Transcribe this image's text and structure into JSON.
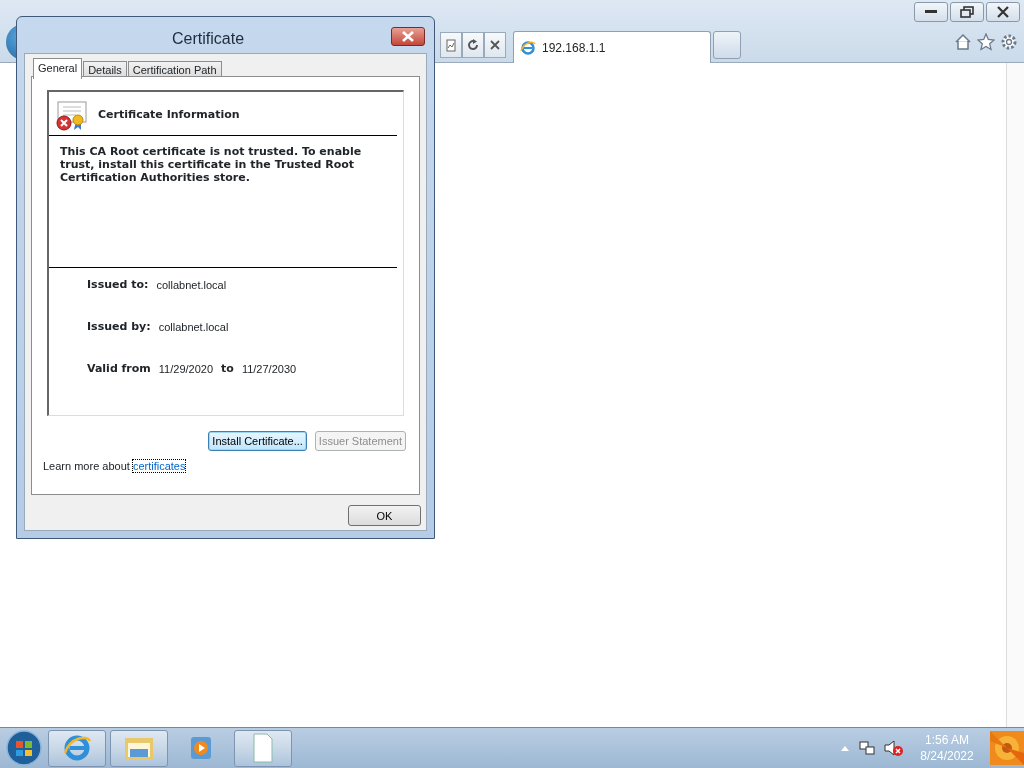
{
  "browser": {
    "tabs": [
      {
        "label": "192.168.1.1",
        "selected": true
      }
    ]
  },
  "dialog": {
    "title": "Certificate",
    "tabs": [
      {
        "label": "General",
        "selected": true
      },
      {
        "label": "Details",
        "selected": false
      },
      {
        "label": "Certification Path",
        "selected": false
      }
    ],
    "heading": "Certificate Information",
    "message": "This CA Root certificate is not trusted. To enable trust, install this certificate in the Trusted Root Certification Authorities store.",
    "fields": [
      {
        "label": "Issued to:",
        "value": "collabnet.local"
      },
      {
        "label": "Issued by:",
        "value": "collabnet.local"
      }
    ],
    "validity": {
      "from_label": "Valid from",
      "from": "11/29/2020",
      "to_label": "to",
      "to": "11/27/2030"
    },
    "buttons": [
      {
        "label": "Install Certificate...",
        "disabled": false
      },
      {
        "label": "Issuer Statement",
        "disabled": true
      }
    ],
    "learn_more": {
      "text": "Learn more about",
      "link": "certificates"
    },
    "ok": "OK"
  },
  "taskbar": {
    "time": "1:56 AM",
    "date": "8/24/2022"
  }
}
